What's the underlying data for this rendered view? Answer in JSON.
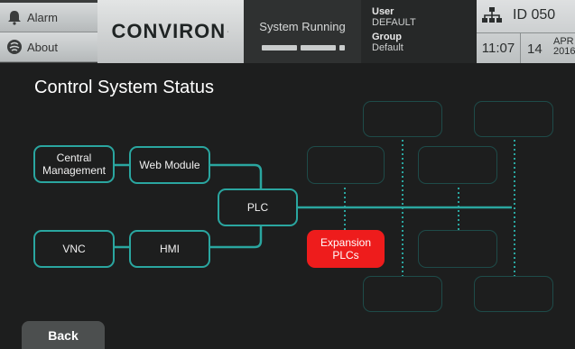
{
  "header": {
    "alarm_label": "Alarm",
    "about_label": "About",
    "brand": "CONVIRON",
    "brand_mark": "·",
    "status_text": "System Running",
    "user_key": "User",
    "user_value": "DEFAULT",
    "group_key": "Group",
    "group_value": "Default",
    "id_text": "ID 050",
    "time": "11:07",
    "day": "14",
    "month": "APR",
    "year": "2016"
  },
  "page": {
    "title": "Control System Status"
  },
  "nodes": {
    "central_management": "Central Management",
    "web_module": "Web Module",
    "plc": "PLC",
    "vnc": "VNC",
    "hmi": "HMI",
    "expansion_plcs": "Expansion PLCs"
  },
  "footer": {
    "back_label": "Back"
  },
  "colors": {
    "accent": "#2aa6a0",
    "alert": "#ee1c1c",
    "background": "#1d1e1e"
  }
}
